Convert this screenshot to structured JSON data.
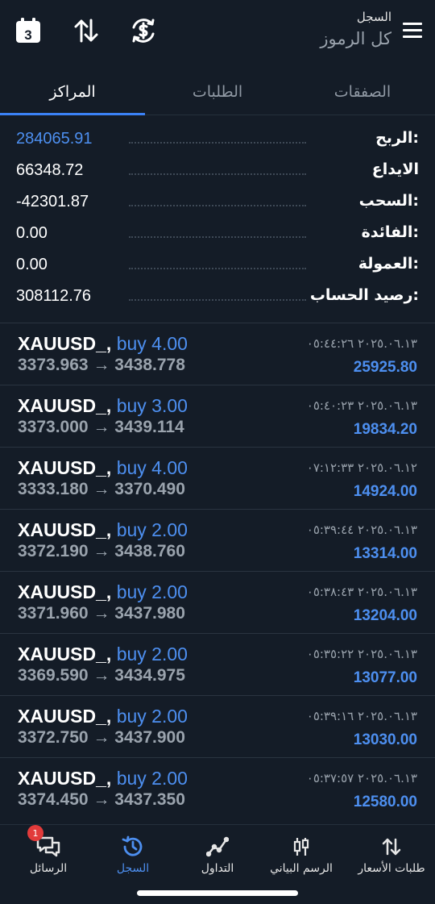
{
  "header": {
    "subtitle": "السجل",
    "title": "كل الرموز",
    "calendar_day": "3",
    "icons": [
      "calendar-icon",
      "sort-arrows-icon",
      "currency-sync-icon",
      "hamburger-menu-icon"
    ]
  },
  "tabs": [
    {
      "label": "الصفقات",
      "active": false
    },
    {
      "label": "الطلبات",
      "active": false
    },
    {
      "label": "المراكز",
      "active": true
    }
  ],
  "summary": [
    {
      "label": "الربح:",
      "value": "284065.91",
      "highlight": true
    },
    {
      "label": "الايداع",
      "value": "66348.72",
      "highlight": false
    },
    {
      "label": "السحب:",
      "value": "-42301.87",
      "highlight": false
    },
    {
      "label": "الفائدة:",
      "value": "0.00",
      "highlight": false
    },
    {
      "label": "العمولة:",
      "value": "0.00",
      "highlight": false
    },
    {
      "label": "رصيد الحساب:",
      "value": "308112.76",
      "highlight": false
    }
  ],
  "positions": [
    {
      "symbol": "XAUUSD_,",
      "side": "buy 4.00",
      "open": "3373.963",
      "arrow": "→",
      "close": "3438.778",
      "time": "٢٠٢٥.٠٦.١٣ ٠٥:٤٤:٢٦",
      "profit": "25925.80"
    },
    {
      "symbol": "XAUUSD_,",
      "side": "buy 3.00",
      "open": "3373.000",
      "arrow": "→",
      "close": "3439.114",
      "time": "٢٠٢٥.٠٦.١٣ ٠٥:٤٠:٢٣",
      "profit": "19834.20"
    },
    {
      "symbol": "XAUUSD_,",
      "side": "buy 4.00",
      "open": "3333.180",
      "arrow": "→",
      "close": "3370.490",
      "time": "٢٠٢٥.٠٦.١٢ ٠٧:١٢:٣٣",
      "profit": "14924.00"
    },
    {
      "symbol": "XAUUSD_,",
      "side": "buy 2.00",
      "open": "3372.190",
      "arrow": "→",
      "close": "3438.760",
      "time": "٢٠٢٥.٠٦.١٣ ٠٥:٣٩:٤٤",
      "profit": "13314.00"
    },
    {
      "symbol": "XAUUSD_,",
      "side": "buy 2.00",
      "open": "3371.960",
      "arrow": "→",
      "close": "3437.980",
      "time": "٢٠٢٥.٠٦.١٣ ٠٥:٣٨:٤٣",
      "profit": "13204.00"
    },
    {
      "symbol": "XAUUSD_,",
      "side": "buy 2.00",
      "open": "3369.590",
      "arrow": "→",
      "close": "3434.975",
      "time": "٢٠٢٥.٠٦.١٣ ٠٥:٣٥:٢٢",
      "profit": "13077.00"
    },
    {
      "symbol": "XAUUSD_,",
      "side": "buy 2.00",
      "open": "3372.750",
      "arrow": "→",
      "close": "3437.900",
      "time": "٢٠٢٥.٠٦.١٣ ٠٥:٣٩:١٦",
      "profit": "13030.00"
    },
    {
      "symbol": "XAUUSD_,",
      "side": "buy 2.00",
      "open": "3374.450",
      "arrow": "→",
      "close": "3437.350",
      "time": "٢٠٢٥.٠٦.١٣ ٠٥:٣٧:٥٧",
      "profit": "12580.00"
    }
  ],
  "bottom_nav": [
    {
      "label": "طلبات الأسعار",
      "icon": "quotes-arrows-icon",
      "active": false
    },
    {
      "label": "الرسم البياني",
      "icon": "candlestick-chart-icon",
      "active": false
    },
    {
      "label": "التداول",
      "icon": "trade-line-icon",
      "active": false
    },
    {
      "label": "السجل",
      "icon": "history-clock-icon",
      "active": true
    },
    {
      "label": "الرسائل",
      "icon": "messages-icon",
      "active": false,
      "badge": "1"
    }
  ],
  "colors": {
    "background": "#141c27",
    "accent": "#4d8ff0",
    "muted": "#9aa3ad",
    "badge": "#e23b3b"
  }
}
